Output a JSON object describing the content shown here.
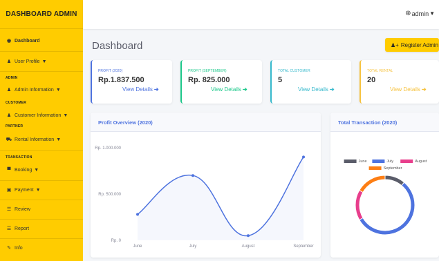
{
  "sidebar": {
    "brand": "DASHBOARD ADMIN",
    "items": {
      "dashboard": "Dashboard",
      "user_profile": "User Profile",
      "admin_info": "Admin Information",
      "customer_info": "Customer Information",
      "rental_info": "Rental Information",
      "booking": "Booking",
      "payment": "Payment",
      "review": "Review",
      "report": "Report",
      "info": "Info"
    },
    "headings": {
      "admin": "ADMIN",
      "customer": "CUSTOMER",
      "partner": "PARTNER",
      "transaction": "TRANSACTION"
    }
  },
  "topbar": {
    "user": "admin"
  },
  "page": {
    "title": "Dashboard",
    "register_label": "Register Admin"
  },
  "cards": [
    {
      "label": "PROFIT (2020)",
      "value": "Rp.1.837.500",
      "link": "View Details",
      "color": "#4e73df"
    },
    {
      "label": "PROFIT (SEPTEMBER)",
      "value": "Rp. 825.000",
      "link": "View Details",
      "color": "#1cc88a"
    },
    {
      "label": "TOTAL CUSTOMER",
      "value": "5",
      "link": "View Details",
      "color": "#36b9cc"
    },
    {
      "label": "TOTAL RENTAL",
      "value": "20",
      "link": "View Details",
      "color": "#f6c23e"
    }
  ],
  "panels": {
    "profit_title": "Profit Overview (2020)",
    "transaction_title": "Total Transaction (2020)"
  },
  "chart_data": [
    {
      "type": "line",
      "title": "Profit Overview (2020)",
      "categories": [
        "June",
        "July",
        "August",
        "September"
      ],
      "values": [
        280000,
        700000,
        50000,
        900000
      ],
      "yticks": [
        "Rp. 0",
        "Rp. 500.000",
        "Rp. 1.000.000"
      ],
      "ylim": [
        0,
        1000000
      ],
      "color": "#4e73df"
    },
    {
      "type": "pie",
      "title": "Total Transaction (2020)",
      "categories": [
        "June",
        "July",
        "August",
        "September"
      ],
      "values": [
        2,
        10,
        3,
        3
      ],
      "colors": [
        "#5a5c69",
        "#4e73df",
        "#e83e8c",
        "#fd7e14"
      ],
      "legend": "top"
    }
  ]
}
